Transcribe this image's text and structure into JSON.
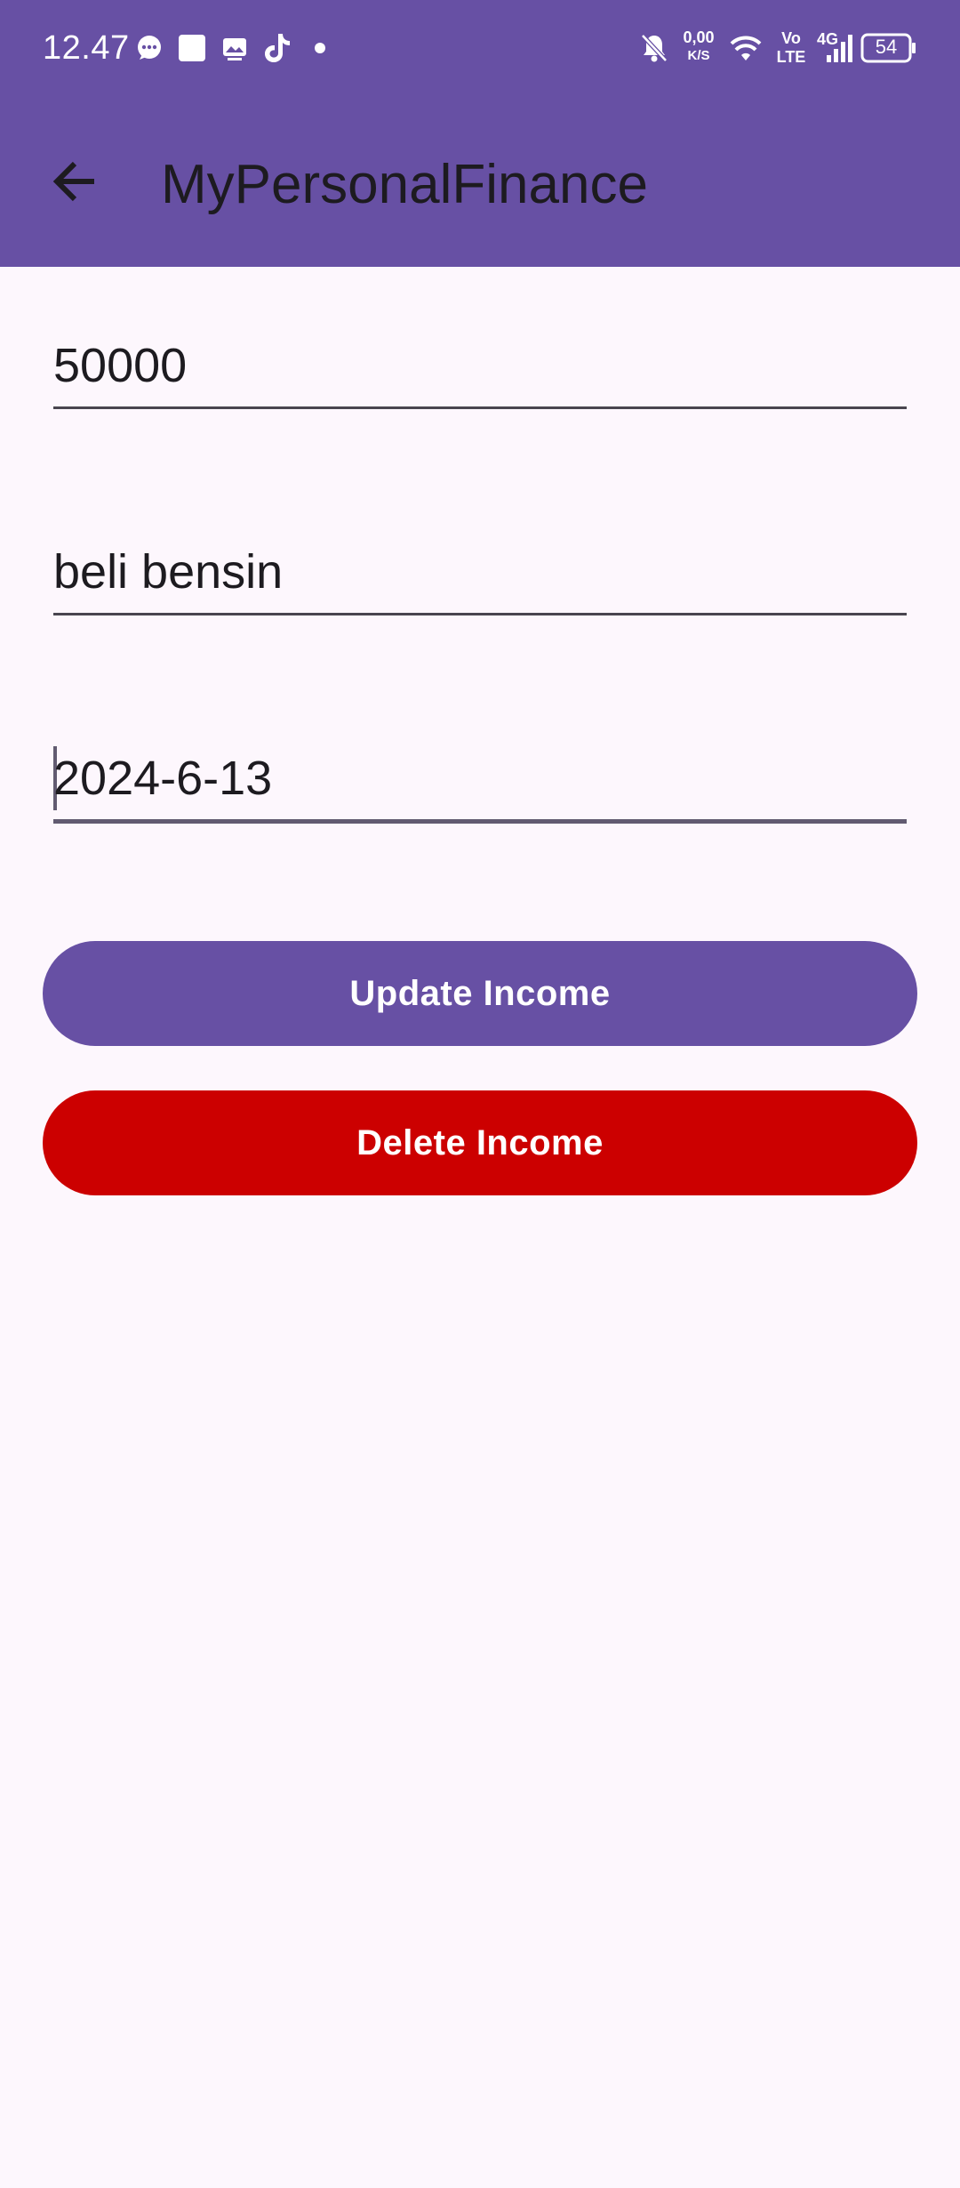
{
  "status_bar": {
    "time": "12.47",
    "network_speed_value": "0,00",
    "network_speed_unit": "K/S",
    "volte_top": "Vo",
    "volte_bottom": "LTE",
    "network_type": "4G",
    "battery_level": "54",
    "icons": [
      "chat-bubble-icon",
      "square-app-icon",
      "image-gallery-icon",
      "tiktok-icon",
      "dot-icon",
      "bell-muted-icon",
      "wifi-icon",
      "signal-icon",
      "battery-icon"
    ]
  },
  "toolbar": {
    "title": "MyPersonalFinance",
    "back_icon": "arrow-back-icon"
  },
  "form": {
    "amount": "50000",
    "description": "beli bensin",
    "date": "2024-6-13"
  },
  "actions": {
    "update_label": "Update Income",
    "delete_label": "Delete Income"
  },
  "colors": {
    "primary": "#6750A4",
    "danger": "#CC0000",
    "background": "#FDF7FD"
  }
}
